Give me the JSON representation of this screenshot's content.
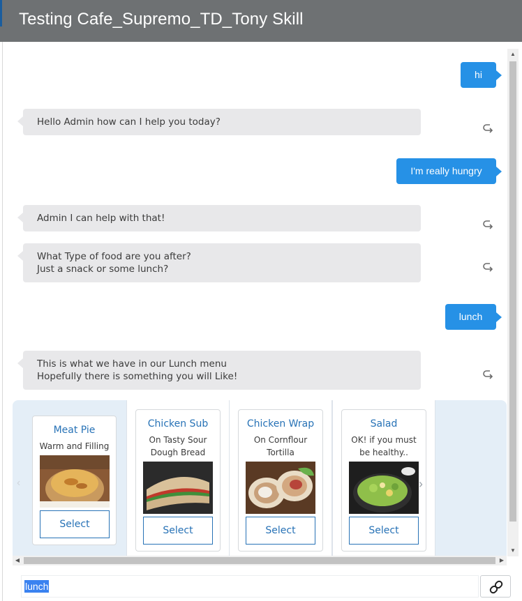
{
  "window": {
    "title": "Testing Cafe_Supremo_TD_Tony Skill"
  },
  "messages": [
    {
      "from": "user",
      "text": "hi"
    },
    {
      "from": "bot",
      "lines": [
        "Hello Admin how can I help you today?"
      ]
    },
    {
      "from": "user",
      "text": "I'm really hungry"
    },
    {
      "from": "bot",
      "lines": [
        "Admin I can help with that!"
      ]
    },
    {
      "from": "bot",
      "lines": [
        "What Type of food are you after?",
        "Just a snack or some lunch?"
      ]
    },
    {
      "from": "user",
      "text": "lunch"
    },
    {
      "from": "bot",
      "lines": [
        "This is what we have in our Lunch menu",
        "Hopefully there is something you will Like!"
      ]
    }
  ],
  "carousel": {
    "cards": [
      {
        "title": "Meat Pie",
        "subtitle": "Warm and Filling",
        "button": "Select",
        "image": "meat-pie-image"
      },
      {
        "title": "Chicken Sub",
        "subtitle": "On Tasty Sour Dough Bread",
        "button": "Select",
        "image": "chicken-sub-image"
      },
      {
        "title": "Chicken Wrap",
        "subtitle": "On Cornflour Tortilla",
        "button": "Select",
        "image": "chicken-wrap-image"
      },
      {
        "title": "Salad",
        "subtitle": "OK! if you must be healthy..",
        "button": "Select",
        "image": "salad-image"
      }
    ],
    "prev_icon": "chevron-left-icon",
    "next_icon": "chevron-right-icon"
  },
  "composer": {
    "value": "lunch",
    "attach_icon": "link-icon"
  },
  "colors": {
    "title_bar": "#6e7173",
    "user_bubble": "#2691e6",
    "bot_bubble": "#e8e8ea",
    "carousel_bg": "#e4eef7",
    "link_blue": "#2772b6"
  }
}
